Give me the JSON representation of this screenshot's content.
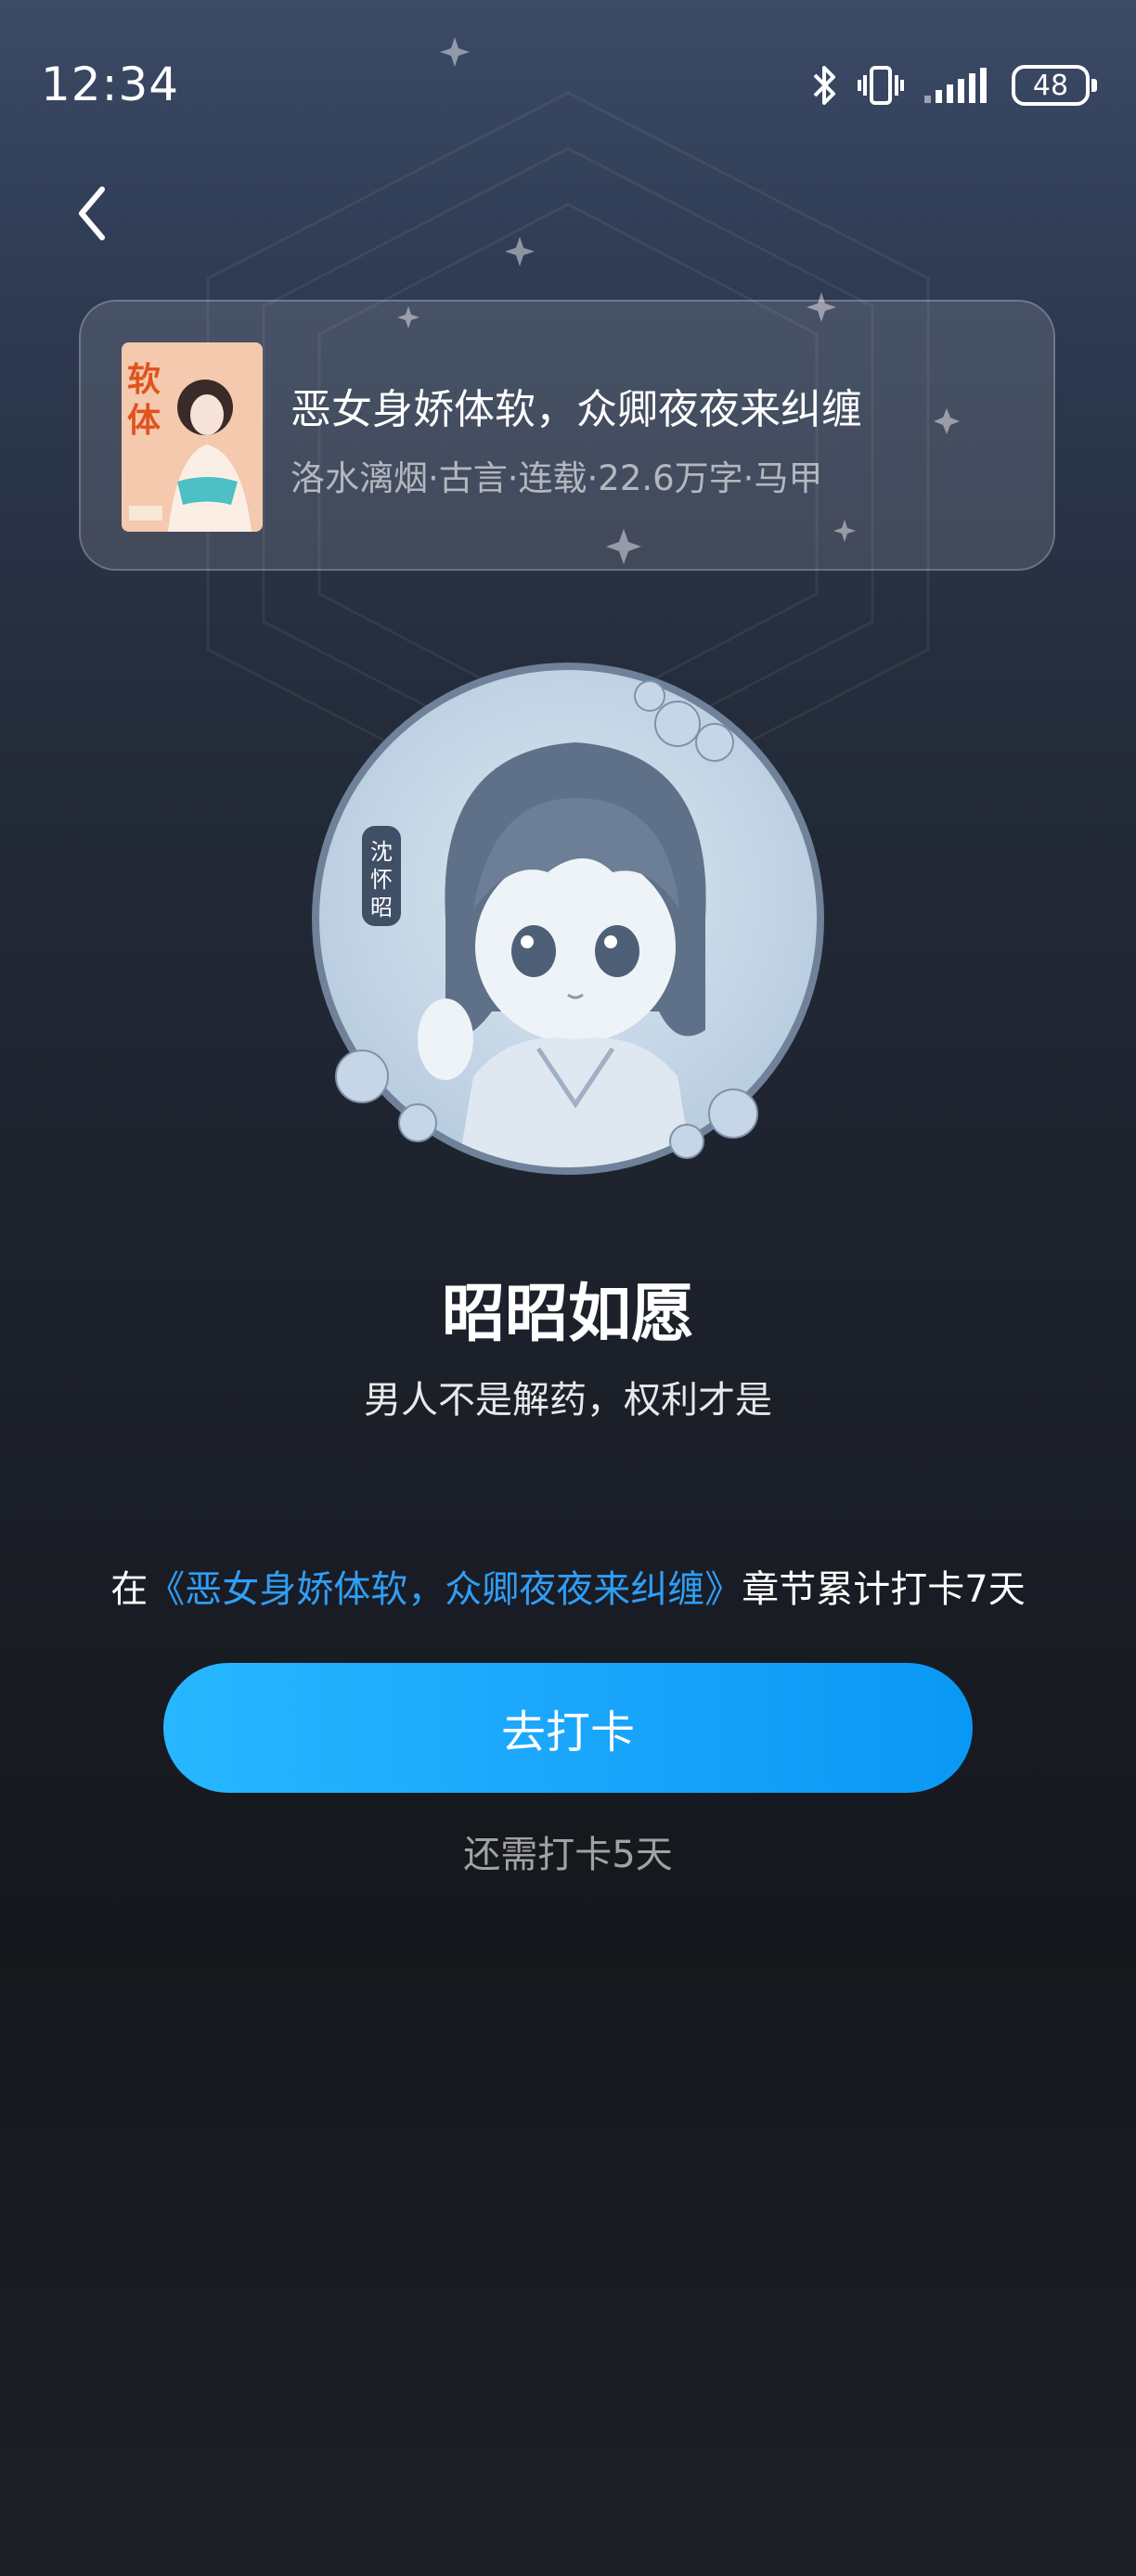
{
  "status_bar": {
    "time": "12:34",
    "battery": "48",
    "icons": [
      "bluetooth-icon",
      "vibrate-icon",
      "signal-icon",
      "battery-icon"
    ]
  },
  "book": {
    "title": "恶女身娇体软，众卿夜夜来纠缠",
    "meta": "洛水漓烟·古言·连载·22.6万字·马甲"
  },
  "badge": {
    "name": "昭昭如愿",
    "subtitle": "男人不是解药，权利才是",
    "avatar_seal_text": "沈怀昭"
  },
  "task": {
    "prefix": "在",
    "book_link": "《恶女身娇体软，众卿夜夜来纠缠》",
    "suffix": "章节累计打卡7天"
  },
  "checkin_button": "去打卡",
  "remaining": "还需打卡5天",
  "colors": {
    "accent": "#1aa6fb",
    "link": "#2f9ef7"
  }
}
